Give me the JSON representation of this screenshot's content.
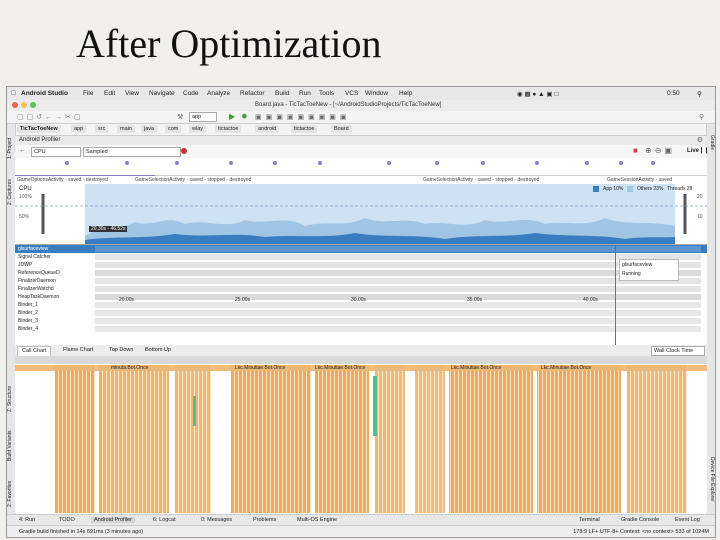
{
  "slide": {
    "title": "After Optimization"
  },
  "mac_menu": {
    "items": [
      "Android Studio",
      "File",
      "Edit",
      "View",
      "Navigate",
      "Code",
      "Analyze",
      "Refactor",
      "Build",
      "Run",
      "Tools",
      "VCS",
      "Window",
      "Help"
    ],
    "clock": "0:50"
  },
  "window": {
    "title": "Board.java - TicTacToeNew - [~/AndroidStudioProjects/TicTacToeNew]"
  },
  "toolbar": {
    "run_config": "app"
  },
  "breadcrumbs": [
    "TicTacToeNew",
    "app",
    "src",
    "main",
    "java",
    "com",
    "wlay",
    "tictactoe",
    "android",
    "tictactoe",
    "Board"
  ],
  "side_tabs": {
    "left": [
      "1: Project",
      "2: Captures",
      "Z: Structure",
      "Build Variants",
      "2: Favorites"
    ],
    "right": [
      "Gradle",
      "Device File Explorer"
    ]
  },
  "profiler": {
    "header": "Android Profiler",
    "monitor": "CPU",
    "config": "Sampled",
    "live_label": "Live",
    "events": [
      "GameOptionsActivity - saved - destroyed",
      "GameSelectionActivity - saved - stopped - destroyed",
      "GameSelectionActivity - saved - stopped - destroyed",
      "GameSessionActivity - saved"
    ],
    "cpu_label": "CPU",
    "cpu_y": [
      "100%",
      "50%"
    ],
    "cpu_legend_app": "App 10%",
    "cpu_legend_others": "Others 23%",
    "cpu_threads_label": "Threads 28",
    "threads_y": [
      "20",
      "10"
    ],
    "selection_range": "20.30s - 46.52s",
    "threads": [
      "glsurfaceview",
      "Signal Catcher",
      "JDWP",
      "ReferenceQueueD",
      "FinalizerDaemon",
      "FinalizerWatchd",
      "HeapTaskDaemon",
      "Binder_1",
      "Binder_2",
      "Binder_3",
      "Binder_4"
    ],
    "thread_tooltip_name": "glsurfaceview",
    "thread_tooltip_state": "Running",
    "time_axis": [
      "20.00s",
      "25.00s",
      "30.00s",
      "35.00s",
      "40.00s"
    ],
    "tabs": [
      "Call Chart",
      "Flame Chart",
      "Top Down",
      "Bottom Up"
    ],
    "clock_type": "Wall Clock Time",
    "flame_labels": [
      "Lkc.Minutiae.Bot.Once",
      "Lkc.Minutiae.Bot.Once",
      "Lkc.Minutiae.Bot.Once",
      "Lkc.Minutiae.Bot.Once",
      "minuta.Bot.Once"
    ]
  },
  "bottom_tools": [
    "4: Run",
    "TODO",
    "Android Profiler",
    "6: Logcat",
    "0: Messages",
    "Problems",
    "Multi-OS Engine",
    "Terminal",
    "Gradle Console",
    "Event Log"
  ],
  "status": {
    "message": "Gradle build finished in 14s 691ms (3 minutes ago)",
    "right": "178:9  LF+  UTF-8+  Context: <no context>  533 of 1024M"
  }
}
